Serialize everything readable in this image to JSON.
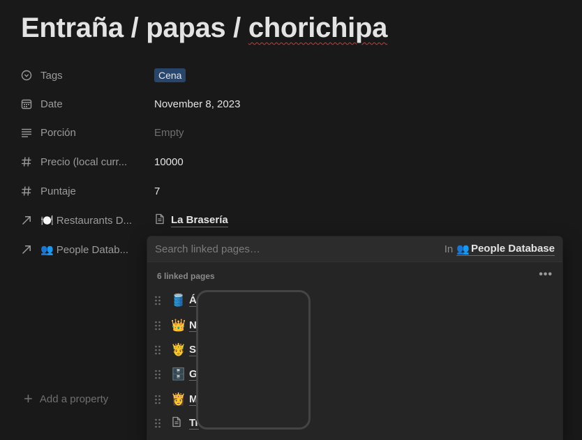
{
  "page": {
    "title_part1": "Entraña / papas / ",
    "title_part2": "chorichipa"
  },
  "properties": [
    {
      "name": "Tags",
      "icon": "chevron-circle-icon",
      "value": "Cena"
    },
    {
      "name": "Date",
      "icon": "calendar-icon",
      "value": "November 8, 2023"
    },
    {
      "name": "Porción",
      "icon": "text-lines-icon",
      "value": "Empty"
    },
    {
      "name": "Precio (local curr...",
      "icon": "hash-icon",
      "value": "10000"
    },
    {
      "name": "Puntaje",
      "icon": "hash-icon",
      "value": "7"
    },
    {
      "name": "Restaurants D...",
      "icon": "relation-arrow-icon",
      "emoji": "🍽️",
      "value": "La Brasería"
    },
    {
      "name": "People Datab...",
      "icon": "relation-arrow-icon",
      "emoji": "👥",
      "value": ""
    }
  ],
  "add_property": "Add a property",
  "panel": {
    "search_placeholder": "Search linked pages…",
    "in_label": "In",
    "database_emoji": "👥",
    "database_name": "People Database",
    "section_title": "6 linked pages",
    "more": "•••",
    "items": [
      {
        "emoji": "🛢️",
        "label": "Á"
      },
      {
        "emoji": "👑",
        "label": "N"
      },
      {
        "emoji": "🤴",
        "label": "S"
      },
      {
        "emoji": "🗄️",
        "label": "G"
      },
      {
        "emoji": "👸",
        "label": "M"
      },
      {
        "emoji": "",
        "label": "Tr"
      }
    ]
  }
}
